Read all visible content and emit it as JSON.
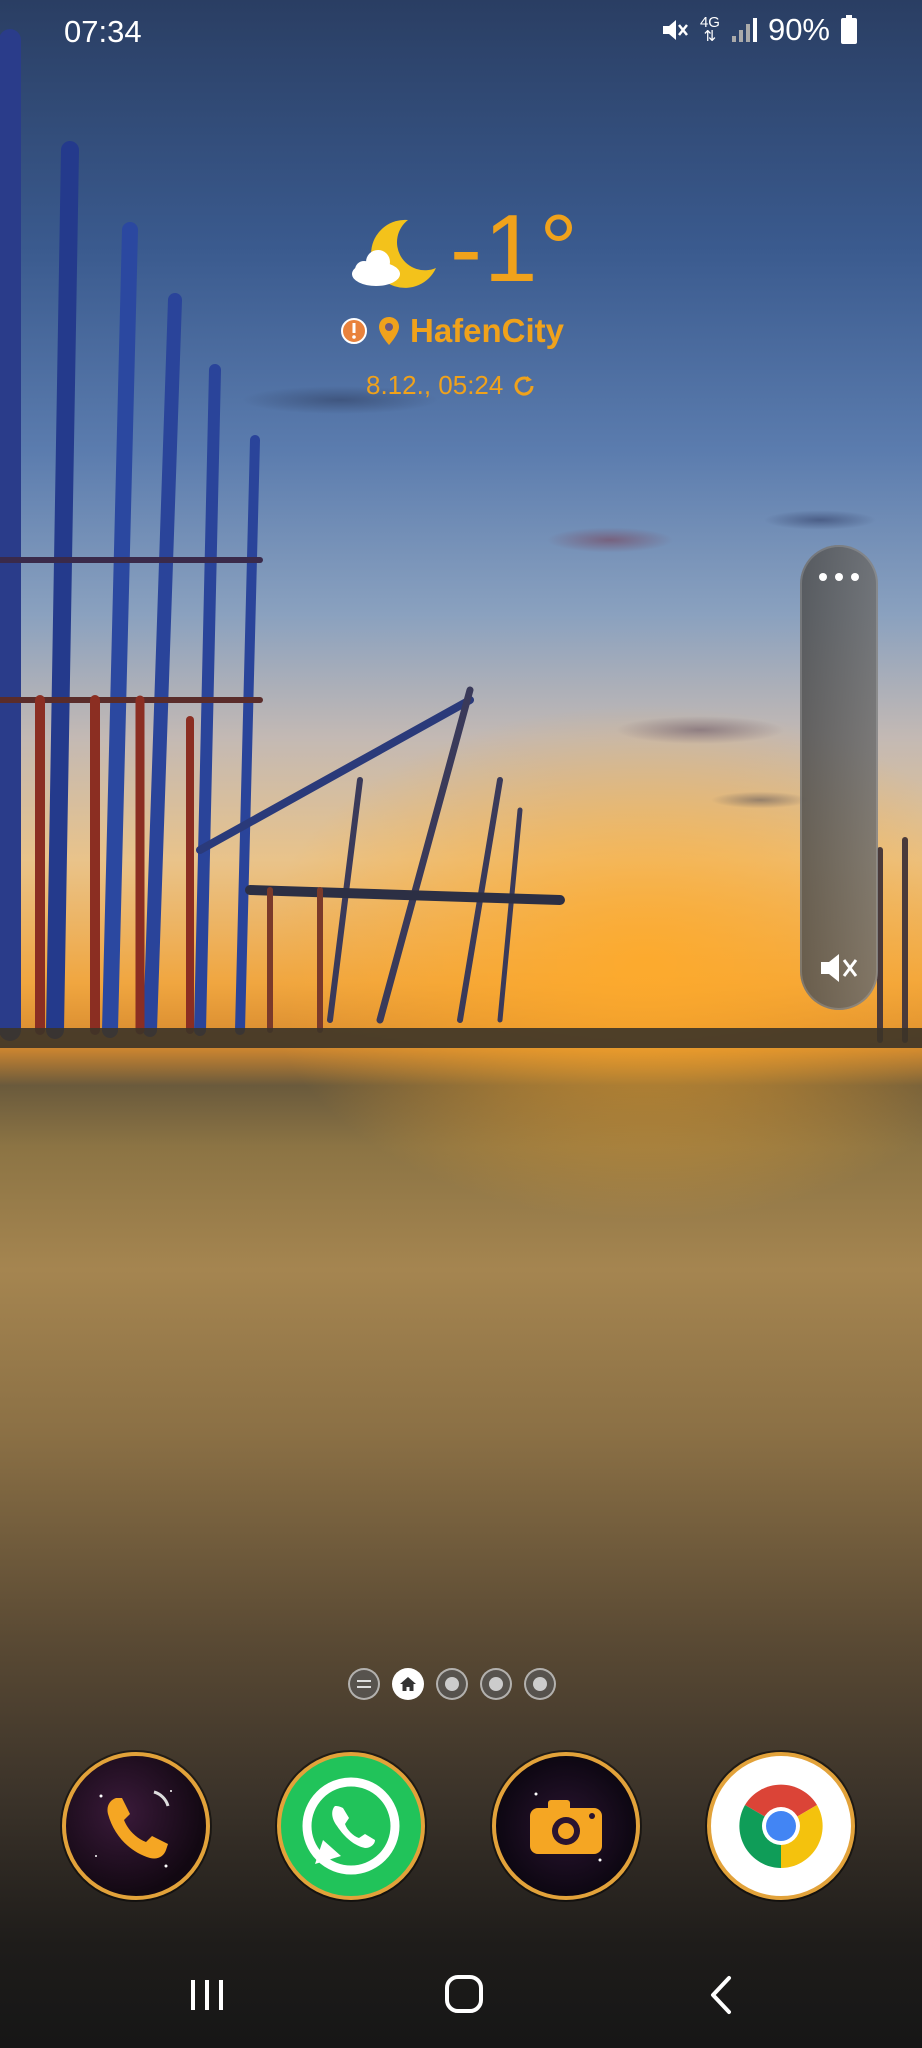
{
  "status_bar": {
    "time": "07:34",
    "network": "4G",
    "battery_percent": "90%",
    "icons": [
      "mute-icon",
      "network-4g-icon",
      "signal-icon",
      "battery-icon"
    ]
  },
  "weather_widget": {
    "temperature": "-1°",
    "condition_icon": "moon-cloud-icon",
    "location": "HafenCity",
    "updated": "8.12., 05:24",
    "accent_color": "#f0a21b"
  },
  "edge_panel": {
    "icons": [
      "more-dots-icon",
      "mute-icon"
    ]
  },
  "page_indicator": {
    "pages": 5,
    "current": 2,
    "icons": [
      "menu-page-icon",
      "home-page-icon"
    ]
  },
  "dock": {
    "apps": [
      {
        "name": "Phone",
        "icon": "phone-icon"
      },
      {
        "name": "WhatsApp",
        "icon": "whatsapp-icon"
      },
      {
        "name": "Camera",
        "icon": "camera-icon"
      },
      {
        "name": "Chrome",
        "icon": "chrome-icon"
      }
    ],
    "border_color": "#e2a23a"
  },
  "nav_bar": {
    "buttons": [
      "recents-icon",
      "home-icon",
      "back-icon"
    ]
  }
}
